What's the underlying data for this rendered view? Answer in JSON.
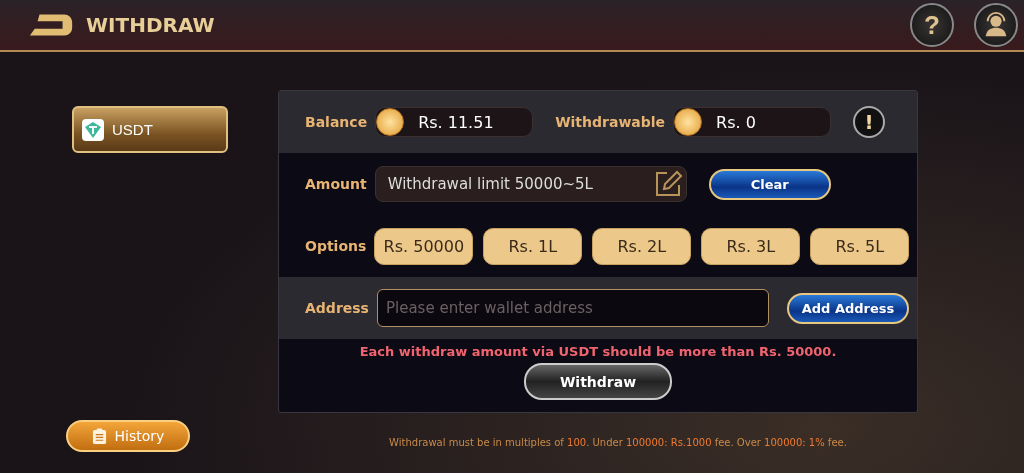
{
  "header": {
    "title": "WITHDRAW",
    "help_icon": "?"
  },
  "sidebar": {
    "methods": [
      {
        "label": "USDT",
        "selected": true
      }
    ],
    "history_button": "History"
  },
  "balance_row": {
    "balance_label": "Balance",
    "balance": "Rs. 11.51",
    "withdrawable_label": "Withdrawable",
    "withdrawable": "Rs. 0",
    "info_icon": "!"
  },
  "amount_row": {
    "label": "Amount",
    "placeholder": "Withdrawal limit 50000~5L",
    "clear_button": "Clear"
  },
  "options_row": {
    "label": "Options",
    "options": [
      "Rs. 50000",
      "Rs. 1L",
      "Rs. 2L",
      "Rs. 3L",
      "Rs. 5L"
    ]
  },
  "address_row": {
    "label": "Address",
    "placeholder": "Please enter wallet address",
    "add_button": "Add Address"
  },
  "warning": "Each withdraw amount via USDT should be more than Rs. 50000.",
  "withdraw_button": "Withdraw",
  "footer_note": "Withdrawal must be in multiples of **100**.   Under **100000: Rs.1000** fee.   Over **100000: 1%** fee."
}
